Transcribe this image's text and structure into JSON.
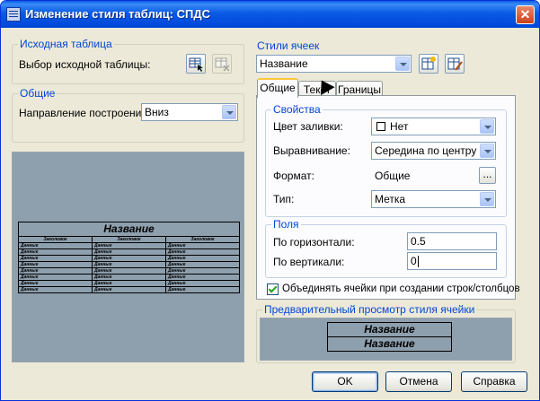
{
  "window": {
    "title": "Изменение стиля таблиц: СПДС",
    "close_glyph": "✕"
  },
  "source_group": {
    "title": "Исходная таблица",
    "label": "Выбор исходной таблицы:"
  },
  "general_group": {
    "title": "Общие",
    "direction_label": "Направление построения:",
    "direction_value": "Вниз"
  },
  "preview_table": {
    "title": "Название",
    "headers": [
      "Заголовок",
      "Заголовок",
      "Заголовок"
    ],
    "cell": "Данные",
    "rows": 8
  },
  "cell_styles": {
    "title": "Стили ячеек",
    "value": "Название"
  },
  "tabs": [
    {
      "label": "Общие"
    },
    {
      "label": "Текст"
    },
    {
      "label": "Границы"
    }
  ],
  "properties": {
    "title": "Свойства",
    "fill_label": "Цвет заливки:",
    "fill_value": "Нет",
    "align_label": "Выравнивание:",
    "align_value": "Середина по центру",
    "format_label": "Формат:",
    "format_value": "Общие",
    "format_button": "...",
    "type_label": "Тип:",
    "type_value": "Метка"
  },
  "margins": {
    "title": "Поля",
    "horizontal_label": "По горизонтали:",
    "horizontal_value": "0.5",
    "vertical_label": "По вертикали:",
    "vertical_value": "0"
  },
  "merge_checkbox": {
    "label": "Объединять ячейки при создании строк/столбцов",
    "checked": true
  },
  "cell_preview": {
    "title": "Предварительный просмотр стиля ячейки",
    "line1": "Название",
    "line2": "Название"
  },
  "buttons": {
    "ok": "OK",
    "cancel": "Отмена",
    "help": "Справка"
  },
  "colors": {
    "title_bar": "#0a5ae5",
    "group_title": "#0046d5",
    "preview_bg": "#8e9fad",
    "active_tab": "#ffc73c"
  },
  "icons": [
    "table-select-icon",
    "table-clear-icon",
    "new-cell-style-icon",
    "manage-cell-styles-icon",
    "mouse-cursor-icon"
  ]
}
